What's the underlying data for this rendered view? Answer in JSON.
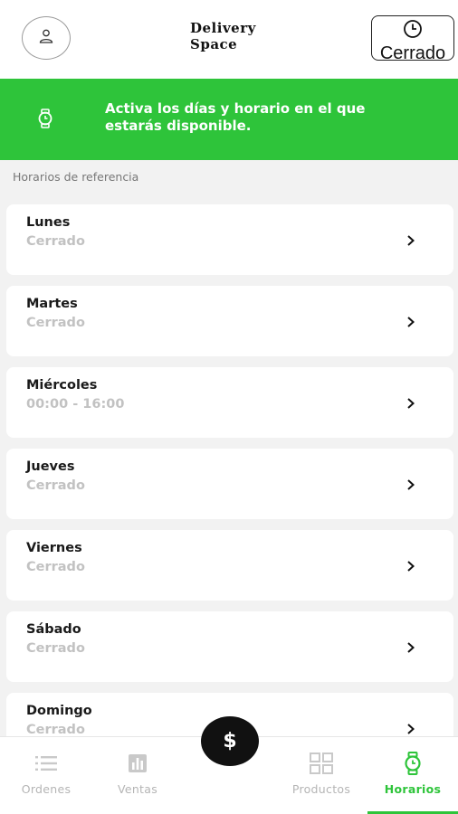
{
  "header": {
    "brand_line1": "Delivery",
    "brand_line2": "Space",
    "status_label": "Cerrado"
  },
  "banner": {
    "text": "Activa los días y horario en el que estarás disponible."
  },
  "section_label": "Horarios de referencia",
  "days": [
    {
      "name": "Lunes",
      "hours": "Cerrado"
    },
    {
      "name": "Martes",
      "hours": "Cerrado"
    },
    {
      "name": "Miércoles",
      "hours": "00:00 - 16:00"
    },
    {
      "name": "Jueves",
      "hours": "Cerrado"
    },
    {
      "name": "Viernes",
      "hours": "Cerrado"
    },
    {
      "name": "Sábado",
      "hours": "Cerrado"
    },
    {
      "name": "Domingo",
      "hours": "Cerrado"
    }
  ],
  "fab": {
    "label": "$"
  },
  "nav": {
    "items": [
      {
        "label": "Ordenes",
        "icon": "list-icon"
      },
      {
        "label": "Ventas",
        "icon": "bar-chart-icon"
      },
      {
        "label": "Productos",
        "icon": "grid-icon"
      },
      {
        "label": "Horarios",
        "icon": "watch-icon"
      }
    ],
    "active": "Horarios"
  },
  "colors": {
    "accent": "#2ec43a",
    "muted": "#c2c2c2",
    "dark": "#111111",
    "background": "#f2f2f2"
  }
}
